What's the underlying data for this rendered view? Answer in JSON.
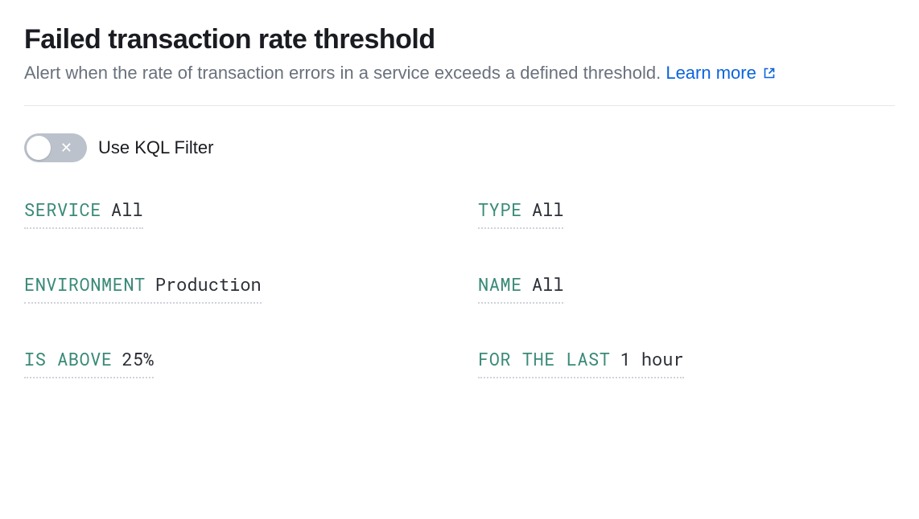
{
  "header": {
    "title": "Failed transaction rate threshold",
    "subtitle_pre": "Alert when the rate of transaction errors in a service exceeds a defined threshold. ",
    "learn_more": "Learn more"
  },
  "toggle": {
    "label": "Use KQL Filter",
    "on": false
  },
  "fields": {
    "service": {
      "label": "SERVICE",
      "value": "All"
    },
    "type": {
      "label": "TYPE",
      "value": "All"
    },
    "environment": {
      "label": "ENVIRONMENT",
      "value": "Production"
    },
    "name": {
      "label": "NAME",
      "value": "All"
    },
    "is_above": {
      "label": "IS ABOVE",
      "value": "25%"
    },
    "for_the_last": {
      "label": "FOR THE LAST",
      "value": "1 hour"
    }
  }
}
